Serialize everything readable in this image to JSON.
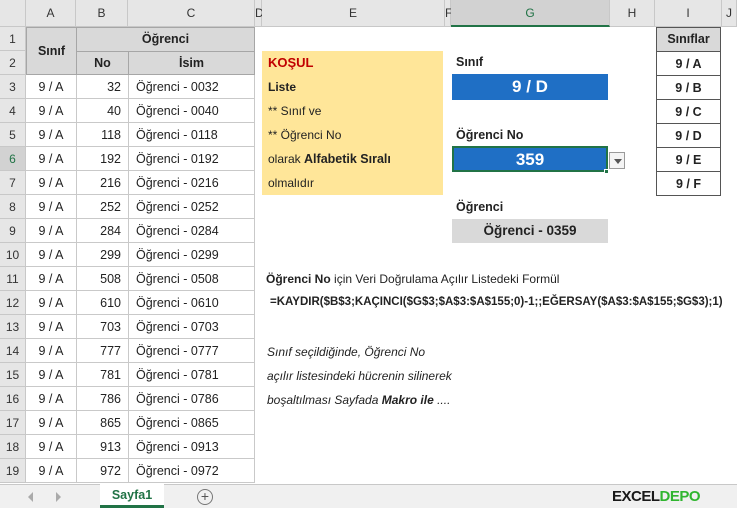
{
  "columns": [
    "A",
    "B",
    "C",
    "D",
    "E",
    "F",
    "G",
    "H",
    "I",
    "J"
  ],
  "rows": [
    "1",
    "2",
    "3",
    "4",
    "5",
    "6",
    "7",
    "8",
    "9",
    "10",
    "11",
    "12",
    "13",
    "14",
    "15",
    "16",
    "17",
    "18",
    "19"
  ],
  "selected_column": "G",
  "selected_row": "6",
  "table": {
    "header_sinif": "Sınıf",
    "header_ogrenci": "Öğrenci",
    "header_no": "No",
    "header_isim": "İsim",
    "records": [
      {
        "sinif": "9 / A",
        "no": "32",
        "isim": "Öğrenci - 0032"
      },
      {
        "sinif": "9 / A",
        "no": "40",
        "isim": "Öğrenci - 0040"
      },
      {
        "sinif": "9 / A",
        "no": "118",
        "isim": "Öğrenci - 0118"
      },
      {
        "sinif": "9 / A",
        "no": "192",
        "isim": "Öğrenci - 0192"
      },
      {
        "sinif": "9 / A",
        "no": "216",
        "isim": "Öğrenci - 0216"
      },
      {
        "sinif": "9 / A",
        "no": "252",
        "isim": "Öğrenci - 0252"
      },
      {
        "sinif": "9 / A",
        "no": "284",
        "isim": "Öğrenci - 0284"
      },
      {
        "sinif": "9 / A",
        "no": "299",
        "isim": "Öğrenci - 0299"
      },
      {
        "sinif": "9 / A",
        "no": "508",
        "isim": "Öğrenci - 0508"
      },
      {
        "sinif": "9 / A",
        "no": "610",
        "isim": "Öğrenci - 0610"
      },
      {
        "sinif": "9 / A",
        "no": "703",
        "isim": "Öğrenci - 0703"
      },
      {
        "sinif": "9 / A",
        "no": "777",
        "isim": "Öğrenci - 0777"
      },
      {
        "sinif": "9 / A",
        "no": "781",
        "isim": "Öğrenci - 0781"
      },
      {
        "sinif": "9 / A",
        "no": "786",
        "isim": "Öğrenci - 0786"
      },
      {
        "sinif": "9 / A",
        "no": "865",
        "isim": "Öğrenci - 0865"
      },
      {
        "sinif": "9 / A",
        "no": "913",
        "isim": "Öğrenci - 0913"
      },
      {
        "sinif": "9 / A",
        "no": "972",
        "isim": "Öğrenci - 0972"
      }
    ]
  },
  "kosul": {
    "title": "KOŞUL",
    "line1": "Liste",
    "line2": "** Sınıf  ve",
    "line3": "** Öğrenci No",
    "line4_prefix": "olarak ",
    "line4_bold": "Alfabetik Sıralı",
    "line5": "olmalıdır"
  },
  "form": {
    "sinif_label": "Sınıf",
    "sinif_value": "9 / D",
    "ogrenci_no_label": "Öğrenci No",
    "ogrenci_no_value": "359",
    "ogrenci_label": "Öğrenci",
    "ogrenci_value": "Öğrenci - 0359"
  },
  "siniflar": {
    "header": "Sınıflar",
    "items": [
      "9 / A",
      "9 / B",
      "9 / C",
      "9 / D",
      "9 / E",
      "9 / F"
    ]
  },
  "formula": {
    "desc_bold": "Öğrenci No",
    "desc_rest": " için Veri Doğrulama Açılır Listedeki Formül",
    "text": "=KAYDIR($B$3;KAÇINCI($G$3;$A$3:$A$155;0)-1;;EĞERSAY($A$3:$A$155;$G$3);1)"
  },
  "note": {
    "line1": "Sınıf seçildiğinde, Öğrenci No",
    "line2": "açılır listesindeki hücrenin silinerek",
    "line3_prefix": "boşaltılması Sayfada  ",
    "line3_bold": "Makro ile",
    "line3_suffix": " ...."
  },
  "tabs": {
    "sheet1": "Sayfa1",
    "add": "+"
  },
  "logo": {
    "part1": "EXCEL",
    "part2": "DEPO",
    "color1": "#1a1a1a",
    "color2": "#2fb52f"
  },
  "colors": {
    "accent": "#217346",
    "selection_blue": "#1f6fc5",
    "condition_bg": "#ffe699",
    "condition_title": "#c00000",
    "header_grey": "#d9d9d9"
  }
}
